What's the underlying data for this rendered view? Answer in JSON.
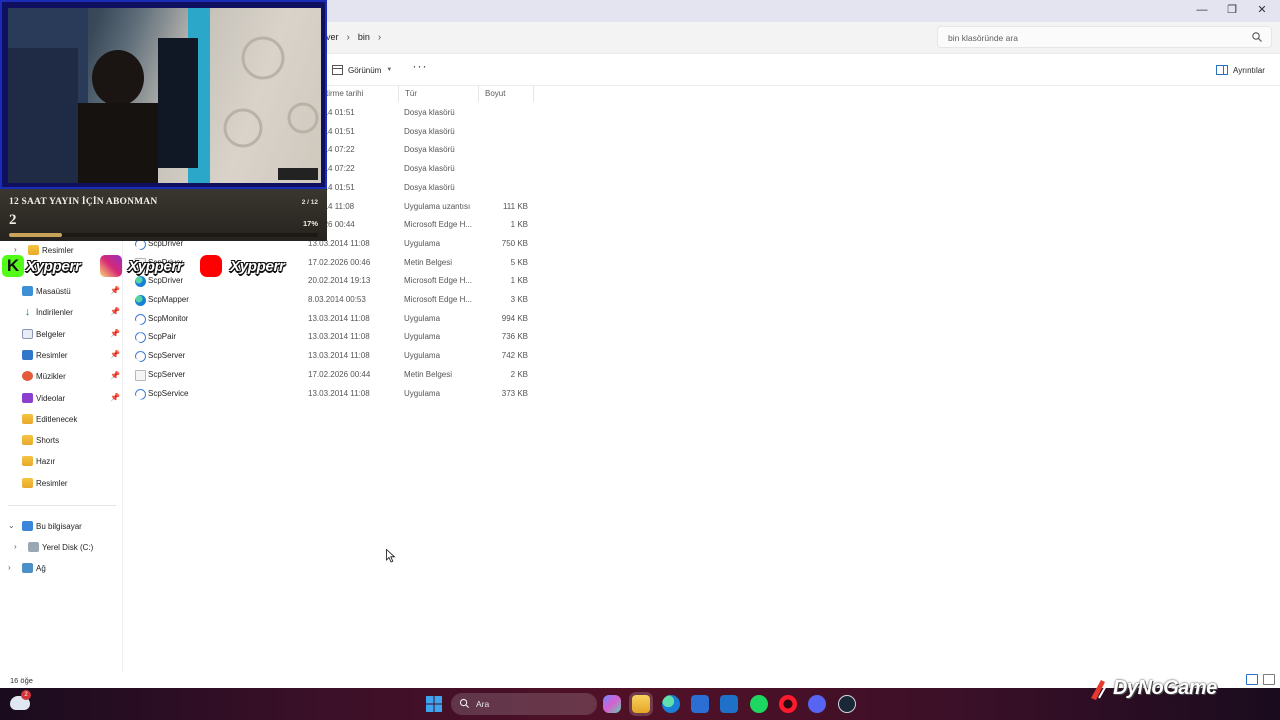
{
  "window": {
    "breadcrumb": [
      "erver",
      "bin"
    ],
    "search_placeholder": "bin klasöründe ara",
    "commands": {
      "view": "Görünüm",
      "more": "···",
      "details": "Ayrıntılar"
    }
  },
  "columns": {
    "date": "tirme tarihi",
    "type": "Tür",
    "size": "Boyut"
  },
  "rows": [
    {
      "name": "",
      "date": "3.2014 01:51",
      "type": "Dosya klasörü",
      "size": "",
      "icon": "folder-icon"
    },
    {
      "name": "",
      "date": "3.2014 01:51",
      "type": "Dosya klasörü",
      "size": "",
      "icon": "folder-icon"
    },
    {
      "name": "",
      "date": "3.2014 07:22",
      "type": "Dosya klasörü",
      "size": "",
      "icon": "folder-icon"
    },
    {
      "name": "",
      "date": "3.2014 07:22",
      "type": "Dosya klasörü",
      "size": "",
      "icon": "folder-icon"
    },
    {
      "name": "",
      "date": "3.2014 01:51",
      "type": "Dosya klasörü",
      "size": "",
      "icon": "folder-icon"
    },
    {
      "name": "",
      "date": "3.2014 11:08",
      "type": "Uygulama uzantısı",
      "size": "111 KB",
      "icon": "dll-icon"
    },
    {
      "name": "",
      "date": "2.2026 00:44",
      "type": "Microsoft Edge H...",
      "size": "1 KB",
      "icon": "edge-icon"
    },
    {
      "name": "ScpDriver",
      "date": "13.03.2014 11:08",
      "type": "Uygulama",
      "size": "750 KB",
      "icon": "app-icon"
    },
    {
      "name": "ScpDriver",
      "date": "17.02.2026 00:46",
      "type": "Metin Belgesi",
      "size": "5 KB",
      "icon": "text-file-icon"
    },
    {
      "name": "ScpDriver",
      "date": "20.02.2014 19:13",
      "type": "Microsoft Edge H...",
      "size": "1 KB",
      "icon": "edge-icon"
    },
    {
      "name": "ScpMapper",
      "date": "8.03.2014 00:53",
      "type": "Microsoft Edge H...",
      "size": "3 KB",
      "icon": "edge-icon"
    },
    {
      "name": "ScpMonitor",
      "date": "13.03.2014 11:08",
      "type": "Uygulama",
      "size": "994 KB",
      "icon": "app-icon"
    },
    {
      "name": "ScpPair",
      "date": "13.03.2014 11:08",
      "type": "Uygulama",
      "size": "736 KB",
      "icon": "app-icon"
    },
    {
      "name": "ScpServer",
      "date": "13.03.2014 11:08",
      "type": "Uygulama",
      "size": "742 KB",
      "icon": "app-icon"
    },
    {
      "name": "ScpServer",
      "date": "17.02.2026 00:44",
      "type": "Metin Belgesi",
      "size": "2 KB",
      "icon": "text-file-icon"
    },
    {
      "name": "ScpService",
      "date": "13.03.2014 11:08",
      "type": "Uygulama",
      "size": "373 KB",
      "icon": "app-icon"
    }
  ],
  "sidebar": {
    "top_partial": "Resimler",
    "quick": [
      {
        "label": "Masaüstü",
        "icon": "desktop-icon",
        "pinned": true
      },
      {
        "label": "İndirilenler",
        "icon": "download-icon",
        "pinned": true
      },
      {
        "label": "Belgeler",
        "icon": "documents-icon",
        "pinned": true
      },
      {
        "label": "Resimler",
        "icon": "pictures-icon",
        "pinned": true
      },
      {
        "label": "Müzikler",
        "icon": "music-icon",
        "pinned": true
      },
      {
        "label": "Videolar",
        "icon": "videos-icon",
        "pinned": true
      },
      {
        "label": "Editlenecek",
        "icon": "folder-icon",
        "pinned": false
      },
      {
        "label": "Shorts",
        "icon": "folder-icon",
        "pinned": false
      },
      {
        "label": "Hazır",
        "icon": "folder-icon",
        "pinned": false
      },
      {
        "label": "Resimler",
        "icon": "folder-icon",
        "pinned": false
      }
    ],
    "this_pc": "Bu bilgisayar",
    "local_disk": "Yerel Disk (C:)",
    "network": "Ağ"
  },
  "status": {
    "item_count": "16 öğe"
  },
  "taskbar": {
    "search_placeholder": "Ara",
    "weather_badge": "2"
  },
  "overlay": {
    "goal_title": "12 SAAT YAYIN İÇİN ABONMAN",
    "goal_count": "2",
    "goal_ratio": "2 / 12",
    "goal_percent_label": "17%",
    "goal_progress": 0.17,
    "social_handle": "Xypperr",
    "watermark": "DyNoGame"
  }
}
